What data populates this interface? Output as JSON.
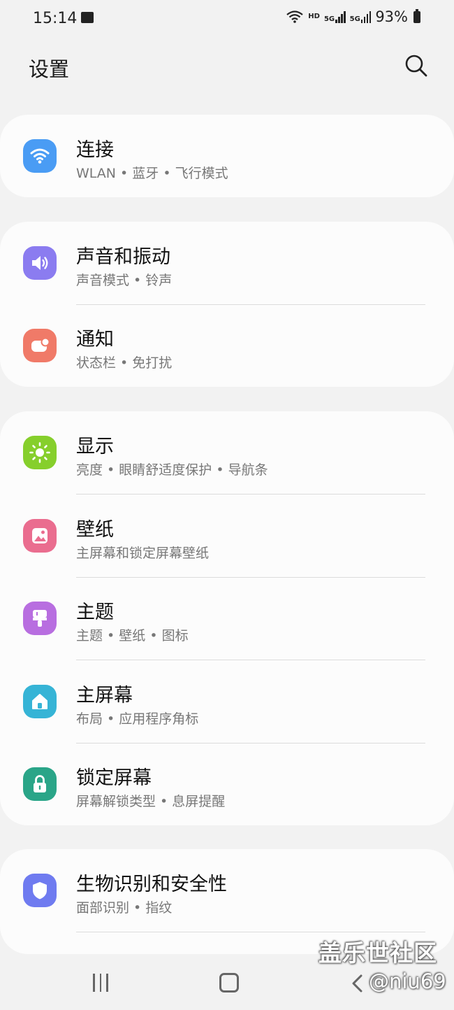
{
  "status_bar": {
    "time": "15:14",
    "network_label": "HD",
    "sim1_label": "5G",
    "sim2_label": "5G",
    "battery": "93%"
  },
  "header": {
    "title": "设置",
    "search_icon": "search-icon"
  },
  "cards": [
    {
      "items": [
        {
          "title": "连接",
          "subtitle": "WLAN • 蓝牙 • 飞行模式",
          "icon": "wifi-icon",
          "color": "#4a9cf4"
        }
      ]
    },
    {
      "items": [
        {
          "title": "声音和振动",
          "subtitle": "声音模式 • 铃声",
          "icon": "speaker-icon",
          "color": "#8b7cf0"
        },
        {
          "title": "通知",
          "subtitle": "状态栏 • 免打扰",
          "icon": "notification-icon",
          "color": "#f07a68"
        }
      ]
    },
    {
      "items": [
        {
          "title": "显示",
          "subtitle": "亮度 • 眼睛舒适度保护 • 导航条",
          "icon": "sun-icon",
          "color": "#86cf2c"
        },
        {
          "title": "壁纸",
          "subtitle": "主屏幕和锁定屏幕壁纸",
          "icon": "picture-icon",
          "color": "#ea6d8f"
        },
        {
          "title": "主题",
          "subtitle": "主题 • 壁纸 • 图标",
          "icon": "paintbrush-icon",
          "color": "#b86ee0"
        },
        {
          "title": "主屏幕",
          "subtitle": "布局 • 应用程序角标",
          "icon": "home-icon",
          "color": "#36b4d6"
        },
        {
          "title": "锁定屏幕",
          "subtitle": "屏幕解锁类型 • 息屏提醒",
          "icon": "lock-icon",
          "color": "#2aa588"
        }
      ]
    },
    {
      "items": [
        {
          "title": "生物识别和安全性",
          "subtitle": "面部识别 • 指纹",
          "icon": "shield-icon",
          "color": "#6f7bf0"
        }
      ]
    }
  ],
  "watermark": {
    "line1": "盖乐世社区",
    "line2": "@niu69"
  }
}
